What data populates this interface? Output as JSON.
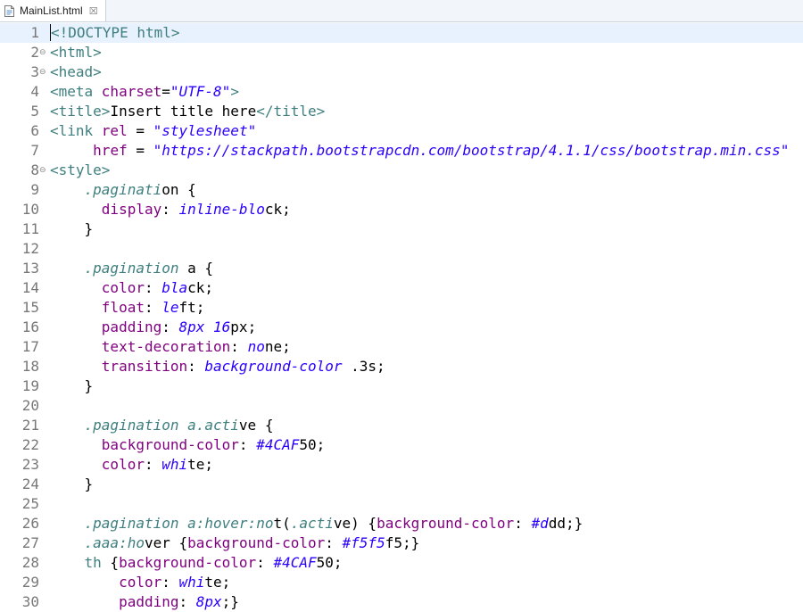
{
  "tab": {
    "label": "MainList.html",
    "icon": "html-file-icon",
    "close_icon": "close-icon",
    "close_glyph": "☒"
  },
  "lines": [
    {
      "n": "1",
      "fold": "",
      "current": true,
      "parts": [
        [
          "tag",
          "<!DOCTYPE html>"
        ]
      ]
    },
    {
      "n": "2",
      "fold": "⊖",
      "parts": [
        [
          "tag",
          "<html>"
        ]
      ]
    },
    {
      "n": "3",
      "fold": "⊖",
      "parts": [
        [
          "tag",
          "<head>"
        ]
      ]
    },
    {
      "n": "4",
      "fold": "",
      "parts": [
        [
          "tag",
          "<meta "
        ],
        [
          "attr",
          "charset"
        ],
        [
          "plain",
          "="
        ],
        [
          "str",
          "\"UTF-8\""
        ],
        [
          "tag",
          ">"
        ]
      ]
    },
    {
      "n": "5",
      "fold": "",
      "parts": [
        [
          "tag",
          "<title>"
        ],
        [
          "plain",
          "Insert title here"
        ],
        [
          "tag",
          "</title>"
        ]
      ]
    },
    {
      "n": "6",
      "fold": "",
      "parts": [
        [
          "tag",
          "<link "
        ],
        [
          "attr",
          "rel"
        ],
        [
          "plain",
          " = "
        ],
        [
          "str",
          "\"stylesheet\""
        ]
      ]
    },
    {
      "n": "7",
      "fold": "",
      "parts": [
        [
          "plain",
          "     "
        ],
        [
          "attr",
          "href"
        ],
        [
          "plain",
          " = "
        ],
        [
          "str",
          "\"https://stackpath.bootstrapcdn.com/bootstrap/4.1.1/css/bootstrap.min.css\""
        ]
      ]
    },
    {
      "n": "8",
      "fold": "⊖",
      "parts": [
        [
          "tag",
          "<style>"
        ]
      ]
    },
    {
      "n": "9",
      "fold": "",
      "parts": [
        [
          "plain",
          "    "
        ],
        [
          "sel",
          ".paginati"
        ],
        [
          "plain",
          "on {"
        ]
      ]
    },
    {
      "n": "10",
      "fold": "",
      "parts": [
        [
          "plain",
          "      "
        ],
        [
          "prop",
          "display"
        ],
        [
          "plain",
          ": "
        ],
        [
          "val",
          "inline-blo"
        ],
        [
          "plain",
          "ck;"
        ]
      ]
    },
    {
      "n": "11",
      "fold": "",
      "parts": [
        [
          "plain",
          "    }"
        ]
      ]
    },
    {
      "n": "12",
      "fold": "",
      "parts": []
    },
    {
      "n": "13",
      "fold": "",
      "parts": [
        [
          "plain",
          "    "
        ],
        [
          "sel",
          ".pagination"
        ],
        [
          "plain",
          " a {"
        ]
      ]
    },
    {
      "n": "14",
      "fold": "",
      "parts": [
        [
          "plain",
          "      "
        ],
        [
          "prop",
          "color"
        ],
        [
          "plain",
          ": "
        ],
        [
          "val",
          "bla"
        ],
        [
          "plain",
          "ck;"
        ]
      ]
    },
    {
      "n": "15",
      "fold": "",
      "parts": [
        [
          "plain",
          "      "
        ],
        [
          "prop",
          "float"
        ],
        [
          "plain",
          ": "
        ],
        [
          "val",
          "le"
        ],
        [
          "plain",
          "ft;"
        ]
      ]
    },
    {
      "n": "16",
      "fold": "",
      "parts": [
        [
          "plain",
          "      "
        ],
        [
          "prop",
          "padding"
        ],
        [
          "plain",
          ": "
        ],
        [
          "val",
          "8px 16"
        ],
        [
          "plain",
          "px;"
        ]
      ]
    },
    {
      "n": "17",
      "fold": "",
      "parts": [
        [
          "plain",
          "      "
        ],
        [
          "prop",
          "text-decoration"
        ],
        [
          "plain",
          ": "
        ],
        [
          "val",
          "no"
        ],
        [
          "plain",
          "ne;"
        ]
      ]
    },
    {
      "n": "18",
      "fold": "",
      "parts": [
        [
          "plain",
          "      "
        ],
        [
          "prop",
          "transition"
        ],
        [
          "plain",
          ": "
        ],
        [
          "val",
          "background-color"
        ],
        [
          "plain",
          " .3s;"
        ]
      ]
    },
    {
      "n": "19",
      "fold": "",
      "parts": [
        [
          "plain",
          "    }"
        ]
      ]
    },
    {
      "n": "20",
      "fold": "",
      "parts": []
    },
    {
      "n": "21",
      "fold": "",
      "parts": [
        [
          "plain",
          "    "
        ],
        [
          "sel",
          ".pagination a.acti"
        ],
        [
          "plain",
          "ve {"
        ]
      ]
    },
    {
      "n": "22",
      "fold": "",
      "parts": [
        [
          "plain",
          "      "
        ],
        [
          "prop",
          "background-color"
        ],
        [
          "plain",
          ": "
        ],
        [
          "val",
          "#4CAF"
        ],
        [
          "plain",
          "50;"
        ]
      ]
    },
    {
      "n": "23",
      "fold": "",
      "parts": [
        [
          "plain",
          "      "
        ],
        [
          "prop",
          "color"
        ],
        [
          "plain",
          ": "
        ],
        [
          "val",
          "whi"
        ],
        [
          "plain",
          "te;"
        ]
      ]
    },
    {
      "n": "24",
      "fold": "",
      "parts": [
        [
          "plain",
          "    }"
        ]
      ]
    },
    {
      "n": "25",
      "fold": "",
      "parts": []
    },
    {
      "n": "26",
      "fold": "",
      "parts": [
        [
          "plain",
          "    "
        ],
        [
          "sel",
          ".pagination a:hover:no"
        ],
        [
          "plain",
          "t("
        ],
        [
          "sel",
          ".acti"
        ],
        [
          "plain",
          "ve) {"
        ],
        [
          "prop",
          "background-color"
        ],
        [
          "plain",
          ": "
        ],
        [
          "val",
          "#d"
        ],
        [
          "plain",
          "dd;}"
        ]
      ]
    },
    {
      "n": "27",
      "fold": "",
      "parts": [
        [
          "plain",
          "    "
        ],
        [
          "sel",
          ".aaa:ho"
        ],
        [
          "plain",
          "ver {"
        ],
        [
          "prop",
          "background-color"
        ],
        [
          "plain",
          ": "
        ],
        [
          "val",
          "#f5f5"
        ],
        [
          "plain",
          "f5;}"
        ]
      ]
    },
    {
      "n": "28",
      "fold": "",
      "parts": [
        [
          "plain",
          "    "
        ],
        [
          "tag",
          "th"
        ],
        [
          "plain",
          " {"
        ],
        [
          "prop",
          "background-color"
        ],
        [
          "plain",
          ": "
        ],
        [
          "val",
          "#4CAF"
        ],
        [
          "plain",
          "50;"
        ]
      ]
    },
    {
      "n": "29",
      "fold": "",
      "parts": [
        [
          "plain",
          "        "
        ],
        [
          "prop",
          "color"
        ],
        [
          "plain",
          ": "
        ],
        [
          "val",
          "whi"
        ],
        [
          "plain",
          "te;"
        ]
      ]
    },
    {
      "n": "30",
      "fold": "",
      "parts": [
        [
          "plain",
          "        "
        ],
        [
          "prop",
          "padding"
        ],
        [
          "plain",
          ": "
        ],
        [
          "val",
          "8px"
        ],
        [
          "plain",
          ";}"
        ]
      ]
    }
  ]
}
